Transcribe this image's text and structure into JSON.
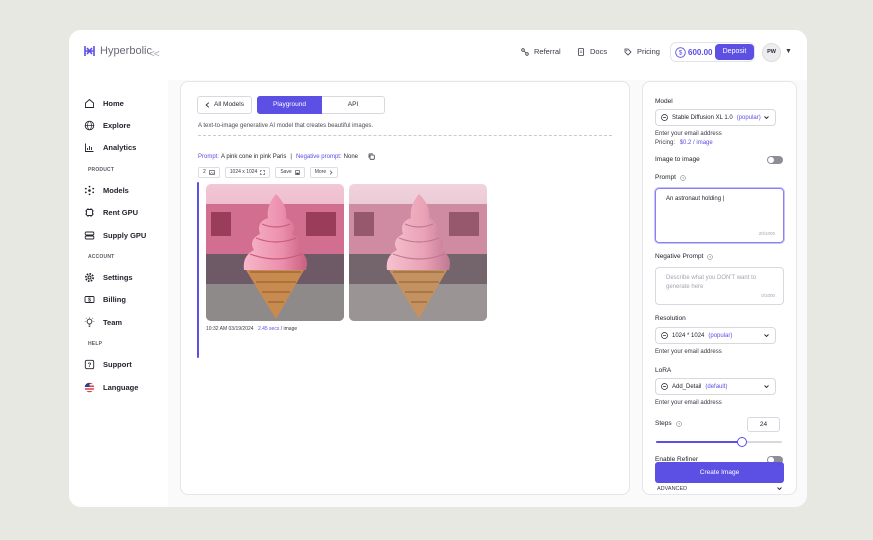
{
  "brand": {
    "name": "Hyperbolic",
    "collapse": "<<"
  },
  "topnav": {
    "referral": "Referral",
    "docs": "Docs",
    "pricing": "Pricing",
    "balance": "600.00",
    "deposit": "Deposit",
    "avatar": "PW"
  },
  "sidebar": {
    "home": "Home",
    "explore": "Explore",
    "analytics": "Analytics",
    "section_product": "PRODUCT",
    "models": "Models",
    "rent_gpu": "Rent GPU",
    "supply_gpu": "Supply GPU",
    "section_account": "ACCOUNT",
    "settings": "Settings",
    "billing": "Billing",
    "team": "Team",
    "section_help": "HELP",
    "support": "Support",
    "language": "Language"
  },
  "main": {
    "tabs": {
      "back": "All Models",
      "playground": "Playground",
      "api": "API"
    },
    "description": "A text-to-image generative AI model that creates beautiful images.",
    "result": {
      "prompt_label": "Prompt:",
      "prompt_value": "A pink cone in pink Paris",
      "separator": "|",
      "neg_label": "Negative prompt:",
      "neg_value": "None",
      "count": "2",
      "size": "1024 x 1024",
      "save": "Save",
      "more": "More",
      "time": "10:32 AM 03/19/2024",
      "duration": "2.45 secs",
      "per_image": "/ image"
    }
  },
  "panel": {
    "model_label": "Model",
    "model_value": "Stable Diffusion XL 1.0",
    "model_tag": "(popular)",
    "model_hint": "Enter your email address",
    "pricing_label": "Pricing:",
    "pricing_value": "$0.2 / image",
    "img2img_label": "Image to image",
    "prompt_label": "Prompt",
    "prompt_value": "An astronaut holding",
    "prompt_counter": "20/1000",
    "neg_label": "Negative Prompt",
    "neg_placeholder": "Describe what you DON'T want to generate here",
    "neg_counter": "0/1000",
    "resolution_label": "Resolution",
    "resolution_value": "1024 * 1024",
    "resolution_tag": "(popular)",
    "resolution_hint": "Enter your email address",
    "lora_label": "LoRA",
    "lora_value": "Add_Detail",
    "lora_tag": "(default)",
    "lora_hint": "Enter your email address",
    "steps_label": "Steps",
    "steps_value": "24",
    "steps_fraction": 0.68,
    "refiner_label": "Enable Refiner",
    "create_button": "Create Image",
    "advanced": "ADVANCED"
  },
  "colors": {
    "accent": "#5b4fe4",
    "text": "#23232e",
    "frame_bg": "#e8e8e3"
  }
}
